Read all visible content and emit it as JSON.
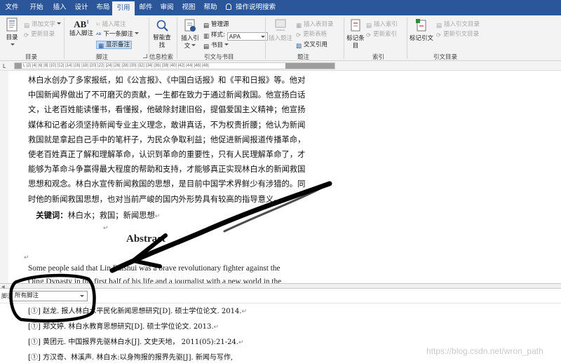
{
  "tabs": {
    "items": [
      "文件",
      "开始",
      "插入",
      "设计",
      "布局",
      "引用",
      "邮件",
      "审阅",
      "视图",
      "帮助"
    ],
    "search": "操作说明搜索"
  },
  "ribbon": {
    "toc": {
      "label": "目录",
      "add_text": "添加文字",
      "update_toc": "更新目录",
      "group": "目录"
    },
    "footnotes": {
      "insert_footnote": "插入脚注",
      "insert_endnote": "插入尾注",
      "next_footnote": "下一条脚注",
      "show_notes": "显示备注",
      "group": "脚注"
    },
    "research": {
      "smart_lookup": "智能查找",
      "group": "信息检索"
    },
    "citations": {
      "insert_citation": "插入引文",
      "manage_sources": "管理源",
      "style_label": "样式:",
      "style_value": "APA",
      "bibliography": "书目",
      "group": "引文与书目"
    },
    "captions": {
      "insert_caption": "插入题注",
      "insert_table_of_figures": "插入表目录",
      "update_table": "更新表格",
      "cross_reference": "交叉引用",
      "group": "题注"
    },
    "index": {
      "mark_entry": "标记条目",
      "insert_index": "插入索引",
      "update_index": "更新索引",
      "group": "索引"
    },
    "authorities": {
      "mark_citation": "标记引文",
      "insert_table_of_authorities": "插入引文目录",
      "update_table": "更新引文目录",
      "group": "引文目录"
    }
  },
  "ruler": {
    "marks": "L  |2| |4| |6| |8| |10| |12| |14| |16| |18| |20| |22| |24| |26| |28| |30| |32| |34| |36| |38| |40| |42| |44| |46| |48|"
  },
  "document": {
    "paragraph_lines": [
      "林白水创办了多家报纸，如《公言报》、《中国白话报》和《平和日报》等。他对",
      "中国新闻界做出了不可磨灭的贡献，一生都在致力于通过新闻救国。他宣扬白话",
      "文，让老百姓能读懂书，看懂报，他破除封建旧俗，提倡爱国主义精神；他宣扬",
      "媒体和记者必须坚持新闻专业主义理念，敢讲真话，不为权贵折腰；他认为新闻",
      "救国就是拿起自己手中的笔杆子，为民众争取利益；他促进新闻报道传播革命，",
      "使老百姓真正了解和理解革命，认识到革命的重要性，只有人民理解革命了，才",
      "能够为革命斗争赢得最大程度的帮助和支持，才能够真正实现林白水的新闻救国",
      "思想和观念。林白水宣传新闻救国的思想，是目前中国学术界鲜少有涉猎的。同",
      "时他的新闻救国思想，也对当前严峻的国内外形势具有较高的指导意义。"
    ],
    "keywords_label": "关键词：",
    "keywords": "林白水；救国；新闻思想",
    "abstract_heading": "Abstract",
    "english_line_1": "Some people said that Lin Baishui was a brave revolutionary fighter against the",
    "english_line_2": "Qing Dynasty in the first half of his life and a journalist with a new world in the"
  },
  "footnote_pane": {
    "label": "脚注",
    "filter_value": "所有脚注",
    "notes": [
      "[①] 赵龙. 报人林白水平民化新闻思想研究[D]. 硕士学位论文. 2014.",
      "[①] 郑文婷. 林白水教育思想研究[D]. 硕士学位论文. 2013.",
      "[①] 黄团元. 中国报界先驱林白水[J]. 文史天地， 2011(05):21-24.",
      "[①] 方汉奇、林溪声. 林白水:以身殉报的报界先驱[J]. 新闻与写作,"
    ]
  },
  "watermark": "https://blog.csdn.net/wron_path",
  "colors": {
    "accent": "#2b579a",
    "ribbon_bg": "#f3f3f3",
    "highlight": "#c5d9f1"
  },
  "icons": [
    "lightbulb-icon",
    "toc-icon",
    "insert-footnote-icon",
    "insert-endnote-icon",
    "next-footnote-icon",
    "show-notes-icon",
    "smart-lookup-icon",
    "insert-citation-icon",
    "manage-sources-icon",
    "bibliography-icon",
    "insert-caption-icon",
    "mark-entry-icon",
    "mark-citation-icon",
    "return-mark-icon"
  ]
}
